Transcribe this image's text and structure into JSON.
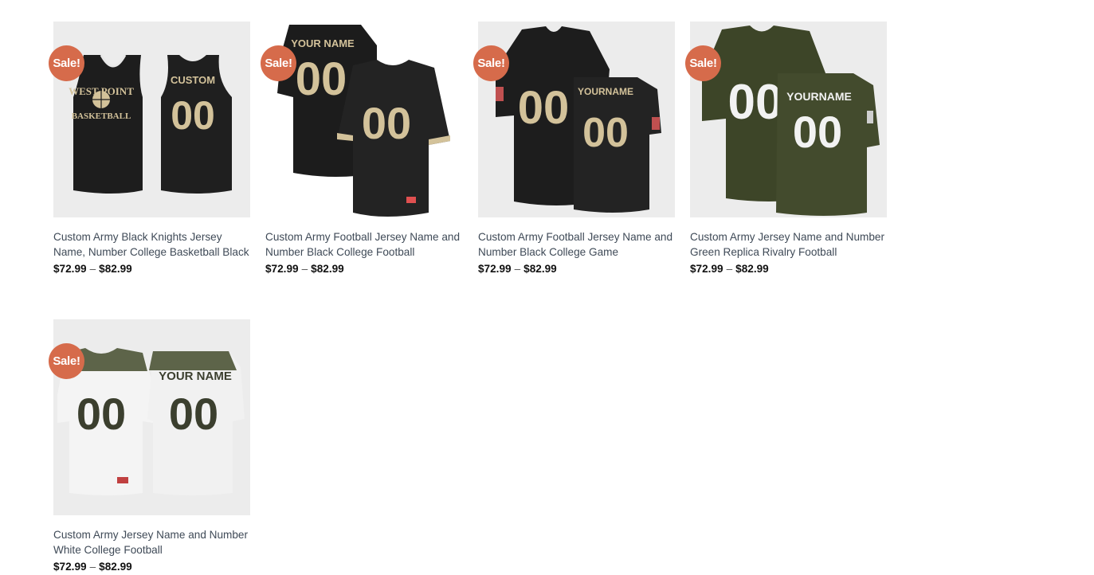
{
  "badge_text": "Sale!",
  "products": [
    {
      "title": "Custom Army Black Knights Jersey Name, Number College Basketball Black",
      "price_min": "$72.99",
      "price_sep": "–",
      "price_max": "$82.99",
      "image": {
        "kind": "basketball-jersey-black",
        "front_text": "WEST POINT",
        "front_text2": "BASKETBALL",
        "back_name": "CUSTOM",
        "number": "00"
      }
    },
    {
      "title": "Custom Army Football Jersey Name and Number Black College Football",
      "price_min": "$72.99",
      "price_sep": "–",
      "price_max": "$82.99",
      "image": {
        "kind": "football-jersey-black",
        "back_name": "YOUR NAME",
        "number": "00"
      }
    },
    {
      "title": "Custom Army Football Jersey Name and Number Black College Game",
      "price_min": "$72.99",
      "price_sep": "–",
      "price_max": "$82.99",
      "image": {
        "kind": "football-jersey-black-game",
        "back_name": "YOURNAME",
        "number": "00"
      }
    },
    {
      "title": "Custom Army Jersey Name and Number Green Replica Rivalry Football",
      "price_min": "$72.99",
      "price_sep": "–",
      "price_max": "$82.99",
      "image": {
        "kind": "football-jersey-green",
        "back_name": "YOURNAME",
        "number": "00"
      }
    },
    {
      "title": "Custom Army Jersey Name and Number White College Football",
      "price_min": "$72.99",
      "price_sep": "–",
      "price_max": "$82.99",
      "image": {
        "kind": "football-jersey-white",
        "back_name": "YOUR NAME",
        "number": "00"
      }
    }
  ],
  "colors": {
    "sale_badge": "#d66b4b",
    "title_text": "#3f4a57",
    "price_text": "#111111",
    "thumb_bg": "#ececec",
    "jersey_black": "#1e1e1e",
    "jersey_gold": "#d3c29a",
    "jersey_green": "#3f4729",
    "jersey_white": "#f4f4f4"
  }
}
